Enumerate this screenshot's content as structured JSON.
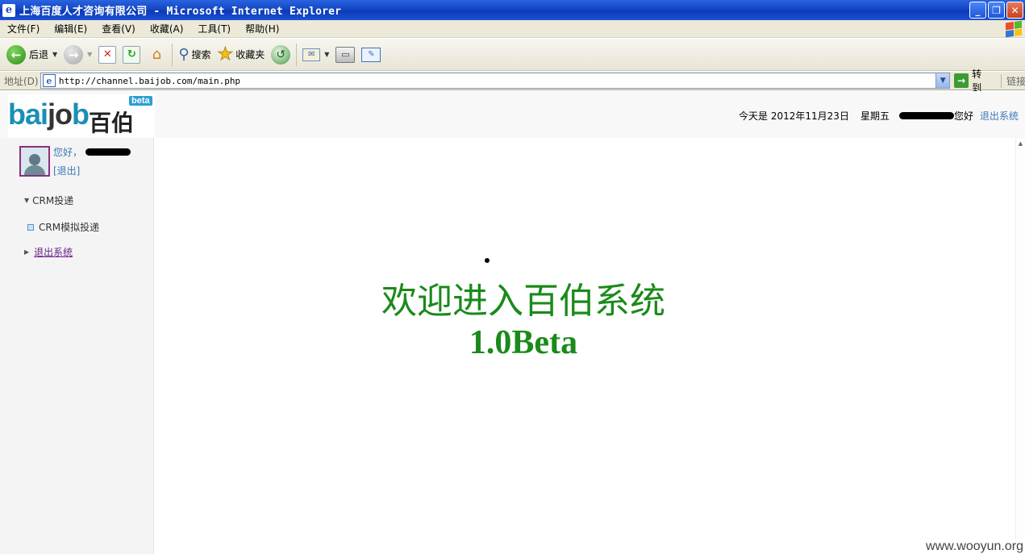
{
  "window": {
    "title": "上海百度人才咨询有限公司 - Microsoft Internet Explorer",
    "controls": [
      "_",
      "❐",
      "✕"
    ]
  },
  "menu": [
    "文件(F)",
    "编辑(E)",
    "查看(V)",
    "收藏(A)",
    "工具(T)",
    "帮助(H)"
  ],
  "toolbar": {
    "back_label": "后退",
    "search_label": "搜索",
    "favorites_label": "收藏夹"
  },
  "address": {
    "label": "地址(D)",
    "url": "http://channel.baijob.com/main.php",
    "go_label": "转到",
    "links_label": "链接"
  },
  "header": {
    "date": "今天是  2012年11月23日",
    "weekday": "星期五",
    "greeting": "您好",
    "logout": "退出系统"
  },
  "logo": {
    "latin_a": "bai",
    "latin_b": "jo",
    "latin_c": "b",
    "chinese": "百伯",
    "badge": "beta"
  },
  "sidebar": {
    "hello": "您好，",
    "exit_short": "[退出]",
    "nav_crm": "CRM投递",
    "nav_crm_sim": "CRM模拟投递",
    "nav_logout": "退出系统"
  },
  "main": {
    "welcome": "欢迎进入百伯系统",
    "version": "1.0Beta"
  },
  "watermark": "www.wooyun.org"
}
